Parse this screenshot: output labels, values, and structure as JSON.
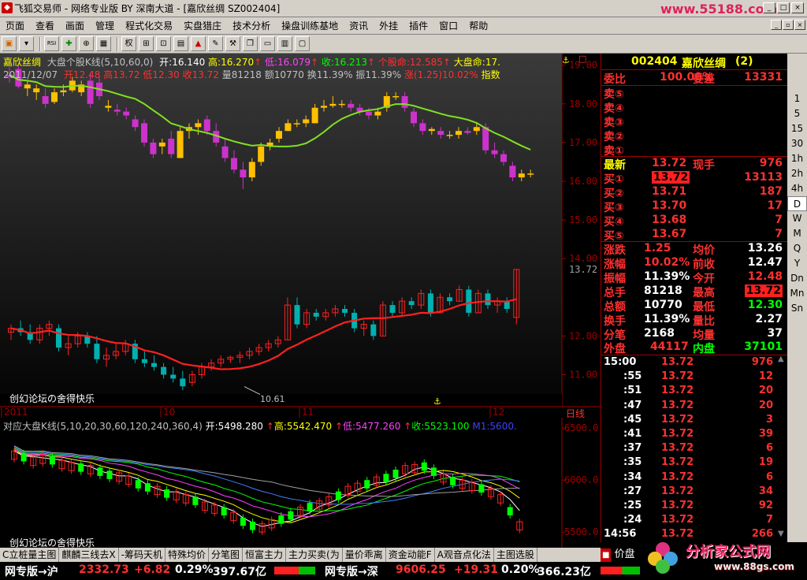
{
  "window": {
    "title": "飞狐交易师 - 网络专业版 BY 深南大道 - [嘉欣丝绸 SZ002404]",
    "site": "www.55188.com"
  },
  "menu": [
    "页面",
    "查看",
    "画面",
    "管理",
    "程式化交易",
    "实盘猎庄",
    "技术分析",
    "操盘训练基地",
    "资讯",
    "外挂",
    "插件",
    "窗口",
    "帮助"
  ],
  "toolbar": {
    "rsi_label": "RSI",
    "quan_label": "权"
  },
  "kline": {
    "name": "嘉欣丝绸",
    "indicator": "大盘个股K线(5,10,60,0)",
    "open_l": "开:",
    "open": "16.140",
    "high_l": "高:",
    "high": "16.270",
    "low_l": "低:",
    "low": "16.079",
    "close_l": "收:",
    "close": "16.213",
    "gm_l": "个股命:",
    "gm": "12.585",
    "dm_l": "大盘命:",
    "dm": "17.",
    "date": "2011/12/07",
    "k_open": "开12.48",
    "k_high": "高13.72",
    "k_low": "低12.30",
    "k_close": "收13.72",
    "vol": "量81218",
    "amt": "额10770",
    "turn": "换11.39%",
    "amp": "振11.39%",
    "chg": "涨(1.25)10.02%",
    "more": "指数",
    "lower_min": "10.61",
    "forum": "创幻论坛の舍得快乐",
    "y_ticks": [
      "19.00",
      "18.00",
      "17.00",
      "16.00",
      "15.00",
      "14.00",
      "12.00",
      "11.00"
    ],
    "cur_price": "13.72",
    "x_labels": [
      "2011",
      "10",
      "11",
      "12"
    ],
    "period": "日线"
  },
  "sub": {
    "indicator": "对应大盘K线(5,10,20,30,60,120,240,360,4)",
    "open": "开:5498.280",
    "high": "高:5542.470",
    "low": "低:5477.260",
    "close": "收:5523.100",
    "m1": "M1:5600.",
    "y_ticks": [
      "6500.0",
      "6000.0",
      "5500.0"
    ],
    "forum": "创幻论坛の舍得快乐"
  },
  "quote": {
    "code": "002404",
    "name": "嘉欣丝绸",
    "count": "(2)",
    "wb_l": "委比",
    "wb": "100.00%",
    "wc_l": "委差",
    "wc": "13331",
    "sells": [
      {
        "l": "卖⑤",
        "p": "",
        "v": ""
      },
      {
        "l": "卖④",
        "p": "",
        "v": ""
      },
      {
        "l": "卖③",
        "p": "",
        "v": ""
      },
      {
        "l": "卖②",
        "p": "",
        "v": ""
      },
      {
        "l": "卖①",
        "p": "",
        "v": ""
      }
    ],
    "last_l": "最新",
    "last": "13.72",
    "xs_l": "现手",
    "xs": "976",
    "buys": [
      {
        "l": "买①",
        "p": "13.72",
        "v": "13113"
      },
      {
        "l": "买②",
        "p": "13.71",
        "v": "187"
      },
      {
        "l": "买③",
        "p": "13.70",
        "v": "17"
      },
      {
        "l": "买④",
        "p": "13.68",
        "v": "7"
      },
      {
        "l": "买⑤",
        "p": "13.67",
        "v": "7"
      }
    ],
    "stats": [
      {
        "l1": "涨跌",
        "v1": "1.25",
        "l2": "均价",
        "v2": "13.26"
      },
      {
        "l1": "涨幅",
        "v1": "10.02%",
        "l2": "前收",
        "v2": "12.47"
      },
      {
        "l1": "振幅",
        "v1": "11.39%",
        "l2": "今开",
        "v2": "12.48"
      },
      {
        "l1": "总手",
        "v1": "81218",
        "l2": "最高",
        "v2": "13.72"
      },
      {
        "l1": "总额",
        "v1": "10770",
        "l2": "最低",
        "v2": "12.30"
      },
      {
        "l1": "换手",
        "v1": "11.39%",
        "l2": "量比",
        "v2": "2.27"
      },
      {
        "l1": "分笔",
        "v1": "2168",
        "l2": "均量",
        "v2": "37"
      }
    ],
    "wp_l": "外盘",
    "wp": "44117",
    "np_l": "内盘",
    "np": "37101",
    "ticks": [
      {
        "t": "15:00",
        "p": "13.72",
        "v": "976"
      },
      {
        "t": ":55",
        "p": "13.72",
        "v": "12"
      },
      {
        "t": ":51",
        "p": "13.72",
        "v": "20"
      },
      {
        "t": ":47",
        "p": "13.72",
        "v": "20"
      },
      {
        "t": ":45",
        "p": "13.72",
        "v": "3"
      },
      {
        "t": ":41",
        "p": "13.72",
        "v": "39"
      },
      {
        "t": ":37",
        "p": "13.72",
        "v": "6"
      },
      {
        "t": ":35",
        "p": "13.72",
        "v": "19"
      },
      {
        "t": ":34",
        "p": "13.72",
        "v": "6"
      },
      {
        "t": ":27",
        "p": "13.72",
        "v": "34"
      },
      {
        "t": ":25",
        "p": "13.72",
        "v": "92"
      },
      {
        "t": ":24",
        "p": "13.72",
        "v": "7"
      },
      {
        "t": "14:56",
        "p": "13.72",
        "v": "266"
      }
    ],
    "bottom_tab": "价盘"
  },
  "periods": [
    "1",
    "5",
    "15",
    "30",
    "1h",
    "2h",
    "4h",
    "D",
    "W",
    "M",
    "Q",
    "Y",
    "Dn",
    "Mn",
    "Sn"
  ],
  "tabs": [
    "C立桩量主图",
    "麒麟三线去X",
    "-筹码天机",
    "特殊均价",
    "分笔图",
    "恒富主力",
    "主力买卖(为",
    "量价乖离",
    "资金动能F",
    "A观音点化法",
    "主图选股"
  ],
  "status": {
    "sh_l": "网专版→沪",
    "sh_p": "2332.73",
    "sh_c": "+6.82",
    "sh_pct": "0.29%",
    "sh_amt": "397.67亿",
    "sz_l": "网专版→深",
    "sz_p": "9606.25",
    "sz_c": "+19.31",
    "sz_pct": "0.20%",
    "sz_amt": "366.23亿",
    "wm": "分析家公式网",
    "wm_url": "www.88gs.com"
  },
  "chart_data": {
    "type": "candlestick",
    "title": "嘉欣丝绸 大盘个股K线(5,10,60,0)",
    "ylim": [
      10.5,
      19.3
    ],
    "upper_candles": [
      [
        18.75,
        18.95,
        18.55,
        18.7
      ],
      [
        18.9,
        19.0,
        18.4,
        18.45
      ],
      [
        18.4,
        18.6,
        18.2,
        18.5
      ],
      [
        18.3,
        18.5,
        18.1,
        18.4
      ],
      [
        18.2,
        18.4,
        17.9,
        18.0
      ],
      [
        18.05,
        18.4,
        18.0,
        18.3
      ],
      [
        18.3,
        18.5,
        18.2,
        18.35
      ],
      [
        18.35,
        18.7,
        18.3,
        18.6
      ],
      [
        18.3,
        18.6,
        18.2,
        18.5
      ],
      [
        18.6,
        18.8,
        17.9,
        18.0
      ],
      [
        18.55,
        18.7,
        18.1,
        18.2
      ],
      [
        17.9,
        18.1,
        17.8,
        17.95
      ],
      [
        17.85,
        18.0,
        17.7,
        17.8
      ],
      [
        17.8,
        17.9,
        17.6,
        17.7
      ],
      [
        17.6,
        17.7,
        17.3,
        17.4
      ],
      [
        17.5,
        17.6,
        16.9,
        17.0
      ],
      [
        17.0,
        17.1,
        16.6,
        16.7
      ],
      [
        16.9,
        17.1,
        16.7,
        17.0
      ],
      [
        17.1,
        17.3,
        16.6,
        16.7
      ],
      [
        16.6,
        17.4,
        16.6,
        17.3
      ],
      [
        17.3,
        17.5,
        17.1,
        17.4
      ],
      [
        17.4,
        17.6,
        17.2,
        17.5
      ],
      [
        17.6,
        17.7,
        17.2,
        17.3
      ],
      [
        17.3,
        17.5,
        16.9,
        17.0
      ],
      [
        16.9,
        17.1,
        16.5,
        16.6
      ],
      [
        16.6,
        16.8,
        16.2,
        16.3
      ],
      [
        16.3,
        16.5,
        15.8,
        16.1
      ],
      [
        16.1,
        16.6,
        16.0,
        16.5
      ],
      [
        16.5,
        17.0,
        16.4,
        16.9
      ],
      [
        16.9,
        17.1,
        16.8,
        17.0
      ],
      [
        17.1,
        17.4,
        17.0,
        17.3
      ],
      [
        17.3,
        17.6,
        17.3,
        17.5
      ],
      [
        17.5,
        17.6,
        17.4,
        17.5
      ],
      [
        17.5,
        17.7,
        17.4,
        17.6
      ],
      [
        17.5,
        18.0,
        17.5,
        17.9
      ],
      [
        17.9,
        18.1,
        17.8,
        17.95
      ],
      [
        17.95,
        18.2,
        17.9,
        18.0
      ],
      [
        18.0,
        18.1,
        17.9,
        18.0
      ],
      [
        18.0,
        18.1,
        17.8,
        17.9
      ],
      [
        17.9,
        18.0,
        17.7,
        17.8
      ],
      [
        17.8,
        17.9,
        17.6,
        17.7
      ],
      [
        17.7,
        17.9,
        17.6,
        17.8
      ],
      [
        17.9,
        18.3,
        17.8,
        18.2
      ],
      [
        18.2,
        18.3,
        18.1,
        18.2
      ],
      [
        18.2,
        18.3,
        17.8,
        17.9
      ],
      [
        17.8,
        17.9,
        17.4,
        17.5
      ],
      [
        17.5,
        17.6,
        17.2,
        17.3
      ],
      [
        17.3,
        17.4,
        17.2,
        17.35
      ],
      [
        17.3,
        17.4,
        17.1,
        17.2
      ],
      [
        17.2,
        17.3,
        17.1,
        17.2
      ],
      [
        17.2,
        17.4,
        17.1,
        17.3
      ],
      [
        17.3,
        17.4,
        17.2,
        17.25
      ],
      [
        17.3,
        17.5,
        17.2,
        17.4
      ],
      [
        17.4,
        17.5,
        16.7,
        16.8
      ],
      [
        16.8,
        17.0,
        16.6,
        16.7
      ],
      [
        16.7,
        16.8,
        16.4,
        16.5
      ],
      [
        16.4,
        16.5,
        16.0,
        16.1
      ],
      [
        16.1,
        16.3,
        16.0,
        16.2
      ],
      [
        16.2,
        16.3,
        16.1,
        16.2
      ]
    ],
    "lower_candles": [
      [
        12.1,
        12.3,
        11.9,
        12.2
      ],
      [
        12.2,
        12.4,
        12.0,
        12.1
      ],
      [
        12.1,
        12.3,
        11.8,
        11.9
      ],
      [
        11.9,
        12.3,
        11.8,
        12.2
      ],
      [
        12.2,
        12.4,
        12.0,
        12.3
      ],
      [
        12.2,
        12.3,
        11.6,
        11.7
      ],
      [
        11.7,
        12.0,
        11.5,
        11.8
      ],
      [
        11.8,
        12.1,
        11.7,
        12.0
      ],
      [
        12.0,
        12.1,
        11.7,
        11.8
      ],
      [
        11.8,
        12.0,
        11.3,
        11.4
      ],
      [
        11.4,
        11.7,
        11.2,
        11.5
      ],
      [
        11.5,
        11.8,
        11.4,
        11.6
      ],
      [
        11.6,
        11.9,
        11.5,
        11.8
      ],
      [
        11.8,
        11.9,
        11.3,
        11.4
      ],
      [
        11.4,
        11.6,
        11.2,
        11.3
      ],
      [
        11.3,
        11.5,
        11.1,
        11.2
      ],
      [
        11.2,
        11.3,
        10.9,
        11.0
      ],
      [
        11.0,
        11.2,
        10.8,
        10.9
      ],
      [
        10.9,
        11.1,
        10.6,
        10.7
      ],
      [
        10.8,
        11.1,
        10.7,
        11.0
      ],
      [
        11.0,
        11.3,
        10.9,
        11.2
      ],
      [
        11.2,
        11.4,
        11.1,
        11.3
      ],
      [
        11.3,
        11.5,
        11.2,
        11.4
      ],
      [
        11.4,
        11.5,
        11.3,
        11.45
      ],
      [
        11.45,
        11.6,
        11.3,
        11.5
      ],
      [
        11.5,
        11.7,
        11.4,
        11.6
      ],
      [
        11.6,
        11.8,
        11.5,
        11.7
      ],
      [
        11.7,
        11.9,
        11.6,
        11.8
      ],
      [
        11.8,
        12.0,
        11.7,
        11.9
      ],
      [
        11.9,
        13.0,
        11.9,
        12.8
      ],
      [
        12.8,
        13.0,
        12.2,
        12.3
      ],
      [
        12.3,
        12.7,
        12.2,
        12.6
      ],
      [
        12.6,
        12.7,
        12.4,
        12.5
      ],
      [
        12.5,
        12.7,
        12.4,
        12.6
      ],
      [
        12.6,
        12.8,
        12.5,
        12.7
      ],
      [
        12.7,
        12.8,
        12.5,
        12.6
      ],
      [
        12.6,
        12.7,
        12.1,
        12.2
      ],
      [
        12.2,
        12.4,
        12.0,
        12.3
      ],
      [
        12.3,
        12.4,
        11.9,
        12.0
      ],
      [
        12.0,
        12.9,
        12.0,
        12.8
      ],
      [
        12.8,
        12.9,
        12.5,
        12.6
      ],
      [
        12.6,
        13.0,
        12.5,
        12.9
      ],
      [
        12.9,
        13.0,
        12.7,
        12.8
      ],
      [
        12.8,
        13.2,
        12.7,
        13.1
      ],
      [
        13.1,
        13.2,
        12.5,
        12.6
      ],
      [
        12.6,
        13.1,
        12.6,
        13.0
      ],
      [
        13.0,
        13.1,
        12.8,
        12.9
      ],
      [
        12.9,
        13.3,
        12.9,
        13.2
      ],
      [
        13.2,
        13.3,
        12.5,
        12.6
      ],
      [
        12.6,
        13.2,
        12.6,
        13.1
      ],
      [
        13.1,
        13.2,
        12.7,
        12.8
      ],
      [
        12.8,
        13.0,
        12.6,
        12.9
      ],
      [
        12.9,
        13.0,
        12.6,
        12.7
      ],
      [
        12.48,
        13.72,
        12.3,
        13.72
      ]
    ],
    "sub_candles_count": 54,
    "sub_ylim": [
      5350,
      6600
    ],
    "x_labels": [
      "2011",
      "10",
      "11",
      "12"
    ]
  }
}
